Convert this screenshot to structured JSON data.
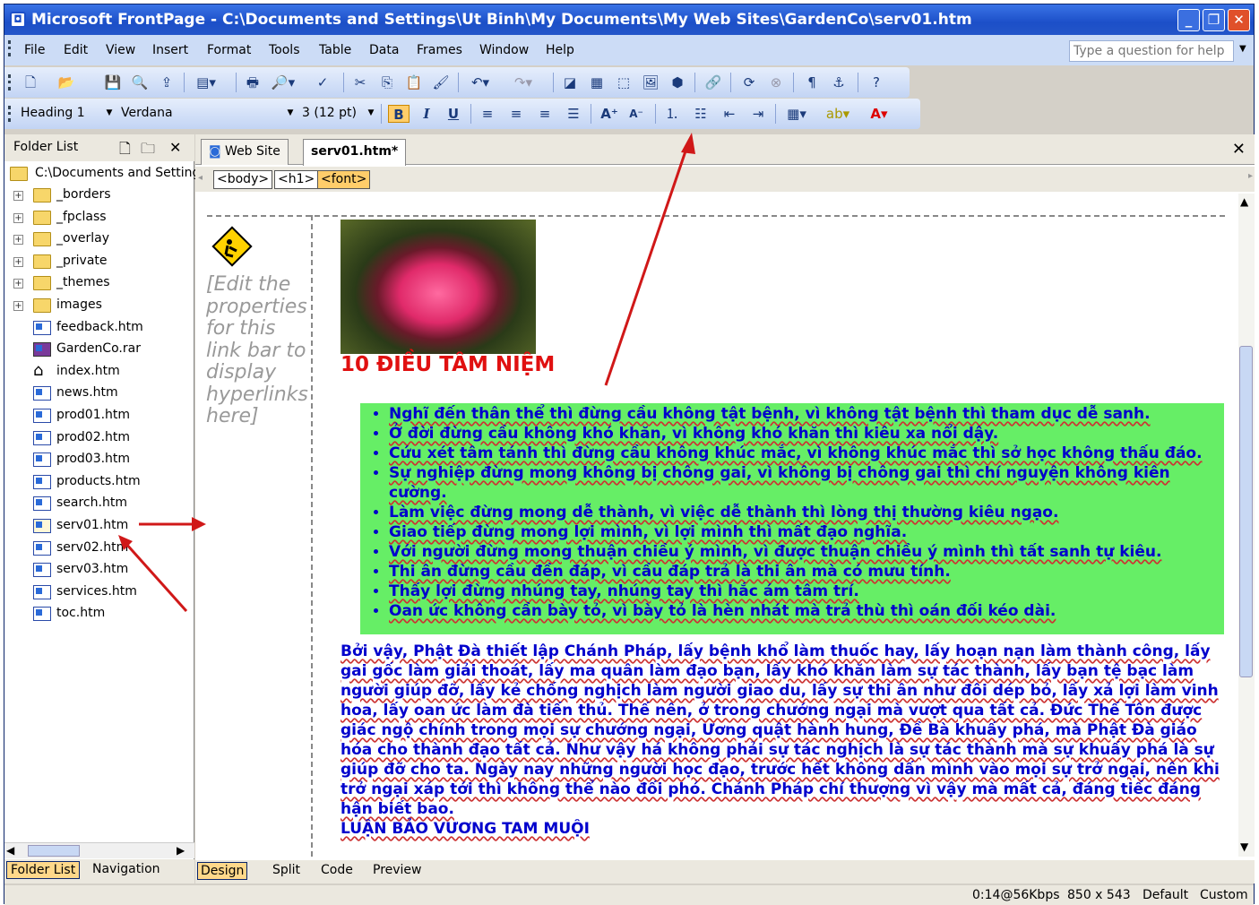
{
  "window": {
    "title": "Microsoft FrontPage - C:\\Documents and Settings\\Ut Binh\\My Documents\\My Web Sites\\GardenCo\\serv01.htm",
    "controls": [
      "minimize-icon",
      "restore-icon",
      "close-icon"
    ]
  },
  "menubar": {
    "items": [
      "File",
      "Edit",
      "View",
      "Insert",
      "Format",
      "Tools",
      "Table",
      "Data",
      "Frames",
      "Window",
      "Help"
    ],
    "help_placeholder": "Type a question for help"
  },
  "formatting": {
    "style": "Heading 1",
    "font": "Verdana",
    "size": "3 (12 pt)",
    "bold": "B",
    "italic": "I",
    "underline": "U"
  },
  "folder_list": {
    "title": "Folder List",
    "root": "C:\\Documents and Setting",
    "items": [
      {
        "label": "_borders",
        "type": "folder"
      },
      {
        "label": "_fpclass",
        "type": "folder"
      },
      {
        "label": "_overlay",
        "type": "folder"
      },
      {
        "label": "_private",
        "type": "folder"
      },
      {
        "label": "_themes",
        "type": "folder"
      },
      {
        "label": "images",
        "type": "folder"
      },
      {
        "label": "feedback.htm",
        "type": "page"
      },
      {
        "label": "GardenCo.rar",
        "type": "archive"
      },
      {
        "label": "index.htm",
        "type": "home"
      },
      {
        "label": "news.htm",
        "type": "page"
      },
      {
        "label": "prod01.htm",
        "type": "page"
      },
      {
        "label": "prod02.htm",
        "type": "page"
      },
      {
        "label": "prod03.htm",
        "type": "page"
      },
      {
        "label": "products.htm",
        "type": "page"
      },
      {
        "label": "search.htm",
        "type": "page"
      },
      {
        "label": "serv01.htm",
        "type": "edit"
      },
      {
        "label": "serv02.htm",
        "type": "page"
      },
      {
        "label": "serv03.htm",
        "type": "page"
      },
      {
        "label": "services.htm",
        "type": "page"
      },
      {
        "label": "toc.htm",
        "type": "page"
      }
    ],
    "bottom_tabs": [
      "Folder List",
      "Navigation"
    ]
  },
  "editor": {
    "tabs": [
      "Web Site",
      "serv01.htm*"
    ],
    "tags": [
      "<body>",
      "<h1>",
      "<font>"
    ],
    "view_tabs": [
      "Design",
      "Split",
      "Code",
      "Preview"
    ]
  },
  "page": {
    "linkbar_text": "[Edit the properties for this link bar to display hyperlinks here]",
    "heading": "10 ĐIỀU TÂM NIỆM",
    "list": [
      "Nghĩ đến thân thể thì đừng cầu không tật bệnh, vì không tật bệnh thì tham dục dễ sanh.",
      "Ở đời đừng cầu không khó khăn, vì không khó khăn thì kiêu xa nổi dậy.",
      "Cứu xét tâm tánh thì đừng cầu không khúc mắc, vì không khúc mắc thì sở học không thấu đáo.",
      "Sự nghiệp đừng mong không bị chông gai, vì không bị chông gai thì chí nguyện không kiên cường.",
      "Làm việc đừng mong dễ thành, vì việc dễ thành thì lòng thị thường kiêu ngạo.",
      "Giao tiếp đừng mong lợi mình, vì lợi mình thì mất đạo nghĩa.",
      "Với người đừng mong thuận chiều ý mình, vì được thuận chiều  ý mình thì tất sanh tự kiêu.",
      "Thi ân đừng cầu đền đáp, vì cầu đáp trả là thi ân mà có mưu tính.",
      "Thấy lợi đừng nhúng tay, nhúng tay thì hắc ám tâm trí.",
      "Oan ức không cần bày tỏ, vì bày tỏ là hèn nhát mà trả thù thì oán đối kéo dài."
    ],
    "paragraph": "Bởi vậy, Phật Đà thiết lập Chánh Pháp, lấy bệnh khổ làm thuốc hay, lấy hoạn nạn làm thành công, lấy gai gốc làm giải thoát, lấy ma quân làm đạo bạn, lấy khó khăn làm sự tác thành, lấy bạn tệ bạc làm người giúp đỡ, lấy kẻ chống nghịch làm người giao du, lấy sự thi ân như đôi dép bỏ, lấy xả lợi làm vinh hoa, lấy oan ức làm đà tiến thủ. Thế nên, ở trong chướng ngại mà vượt qua tất cả. Đức Thế Tôn được giác ngộ chính trong mọi sự chướng ngại, Ương quật hành hung, Đề Bà khuấy phá, mà Phật Đà giáo hóa cho thành đạo tất cả. Như vậy há không phải sự tác nghịch là sự tác thành mà sự khuấy phá là sự giúp đỡ cho ta. Ngày nay những người học đạo, trước hết không dấn mình vào mọi sự trở ngại, nên khi trở ngại xáp tới thì không thể nào đối phó. Chánh Pháp chí thượng vì vậy mà mất cả, đáng tiếc đáng hận biết bao.",
    "signature": "LUẬN BẢO VƯƠNG TAM MUỘI"
  },
  "status": {
    "speed": "0:14@56Kbps",
    "size": "850 x 543",
    "mode": "Default",
    "custom": "Custom"
  },
  "colors": {
    "title_bar": "#1c4fc8",
    "list_background": "#66ee66",
    "text_blue": "#0000cc",
    "heading_red": "#e01010",
    "annotation_arrow": "#d01818"
  }
}
